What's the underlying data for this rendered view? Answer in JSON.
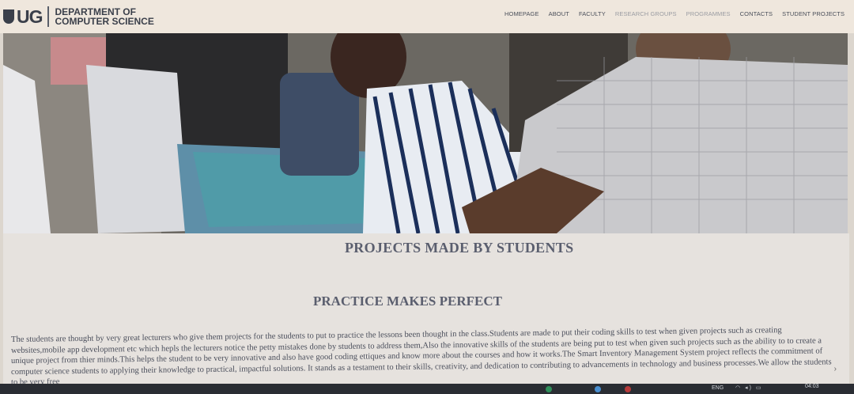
{
  "header": {
    "logo_mark": "UG",
    "dept_line1": "DEPARTMENT OF",
    "dept_line2": "COMPUTER SCIENCE"
  },
  "nav": [
    {
      "label": "HOMEPAGE"
    },
    {
      "label": "ABOUT"
    },
    {
      "label": "FACULTY"
    },
    {
      "label": "RESEARCH GROUPS"
    },
    {
      "label": "PROGRAMMES"
    },
    {
      "label": "CONTACTS"
    },
    {
      "label": "STUDENT PROJECTS"
    }
  ],
  "content": {
    "title": "PROJECTS MADE BY STUDENTS",
    "subtitle": "PRACTICE MAKES PERFECT",
    "paragraph": "The students are thought by very great lecturers who give them projects for the students to put to practice the lessons been thought in the class.Students are made to put their coding skills to test when given projects such as creating websites,mobile app development etc which hepls the lecturers notice the petty mistakes done by students to address them,Also the innovative skills of the students are being put to test when given such projects such as the ability to to create a unique project from thier minds.This helps the student to be very innovative and also have good coding ettiques and know more about the courses and how it works.The Smart Inventory Management System project reflects the commitment of computer science students to applying their knowledge to practical, impactful solutions. It stands as a testament to their skills, creativity, and dedication to contributing to advancements in technology and business processes.We allow the students to be very free"
  },
  "taskbar": {
    "language": "ENG",
    "time": "04:03"
  },
  "colors": {
    "header_bg": "#efe7dd",
    "heading": "#5a5e6e",
    "body_text": "#4b4f5c"
  }
}
